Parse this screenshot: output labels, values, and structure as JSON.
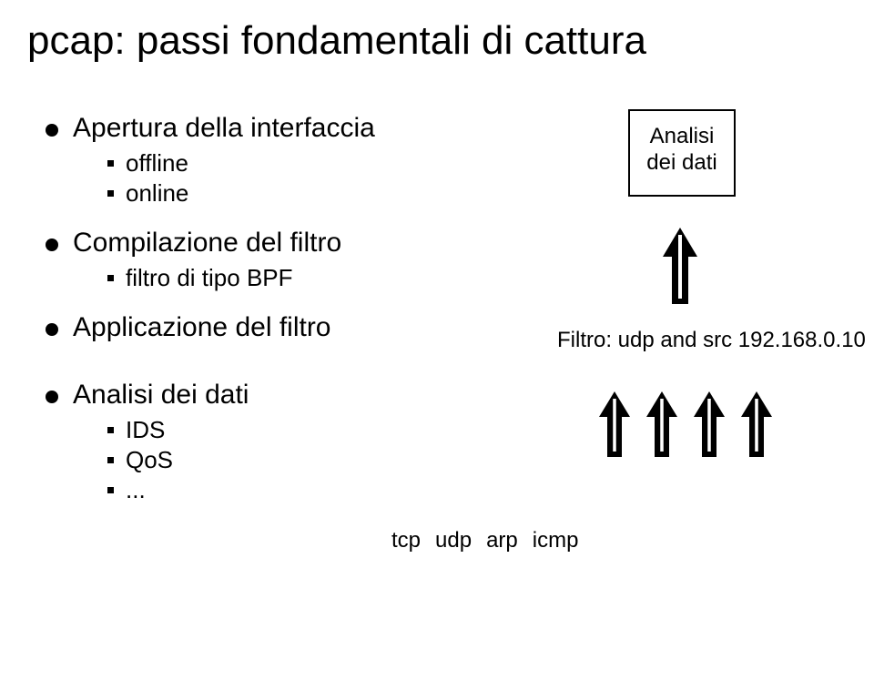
{
  "title": "pcap: passi fondamentali di cattura",
  "bullets": {
    "b1": "Apertura della interfaccia",
    "b1_sub1": "offline",
    "b1_sub2": "online",
    "b2": "Compilazione del filtro",
    "b2_sub1": "filtro di tipo BPF",
    "b3": "Applicazione del filtro",
    "b4": "Analisi dei dati",
    "b4_sub1": "IDS",
    "b4_sub2": "QoS",
    "b4_sub3": "..."
  },
  "box": {
    "line1": "Analisi",
    "line2": "dei dati"
  },
  "filter_text": "Filtro: udp and src 192.168.0.10",
  "protocols": {
    "p1": "tcp",
    "p2": "udp",
    "p3": "arp",
    "p4": "icmp"
  }
}
